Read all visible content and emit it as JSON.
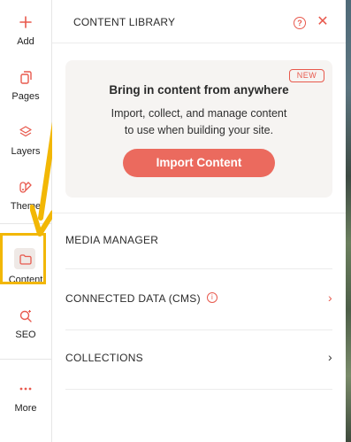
{
  "rail": {
    "items": [
      {
        "label": "Add",
        "icon": "plus-icon"
      },
      {
        "label": "Pages",
        "icon": "pages-icon"
      },
      {
        "label": "Layers",
        "icon": "layers-icon"
      },
      {
        "label": "Theme",
        "icon": "theme-icon"
      },
      {
        "label": "Content",
        "icon": "folder-icon"
      },
      {
        "label": "SEO",
        "icon": "seo-icon"
      },
      {
        "label": "More",
        "icon": "more-dots-icon"
      }
    ]
  },
  "panel": {
    "title": "CONTENT LIBRARY",
    "help_icon": "?",
    "close_icon": "✕",
    "card": {
      "badge": "NEW",
      "title": "Bring in content from anywhere",
      "desc_line1": "Import, collect, and manage content",
      "desc_line2": "to use when building your site.",
      "button": "Import Content"
    },
    "rows": [
      {
        "label": "MEDIA MANAGER"
      },
      {
        "label": "CONNECTED DATA (CMS)",
        "info": "i",
        "chevron": "›"
      },
      {
        "label": "COLLECTIONS",
        "chevron": "›"
      }
    ]
  },
  "colors": {
    "accent": "#e8594d",
    "button": "#eb6a5e",
    "highlight": "#f2b705",
    "card_bg": "#f6f4f2"
  }
}
